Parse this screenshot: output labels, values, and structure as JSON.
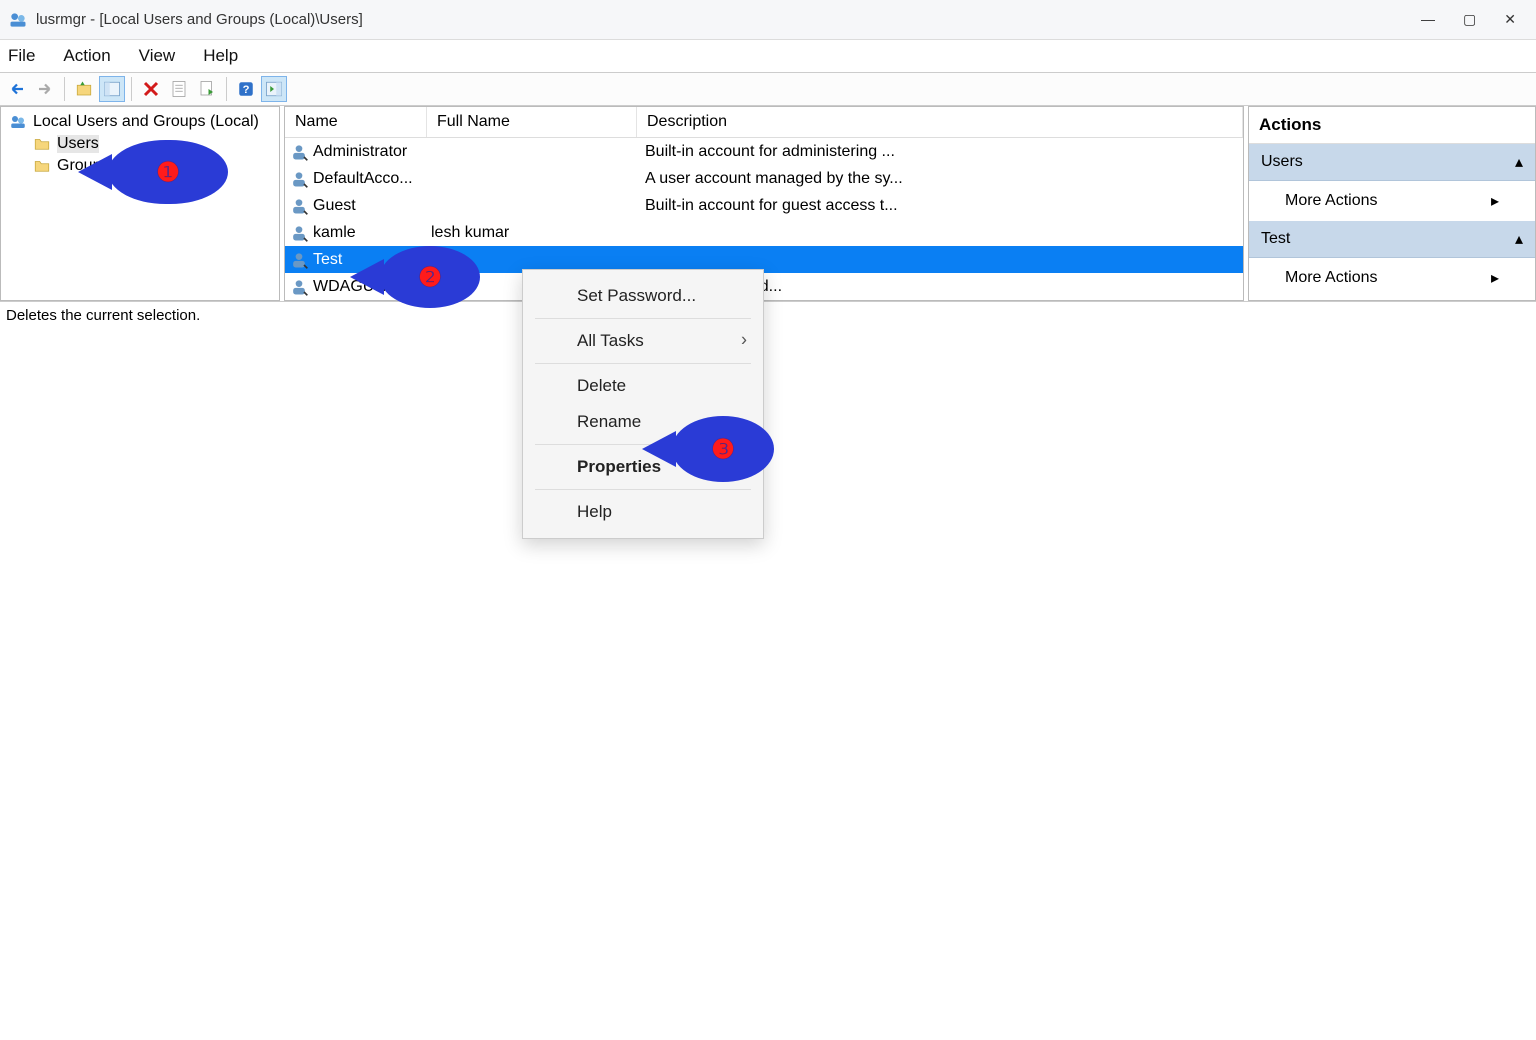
{
  "title": "lusrmgr - [Local Users and Groups (Local)\\Users]",
  "menu": {
    "file": "File",
    "action": "Action",
    "view": "View",
    "help": "Help"
  },
  "tree": {
    "root": "Local Users and Groups (Local)",
    "users": "Users",
    "groups": "Groups"
  },
  "list": {
    "cols": {
      "name": "Name",
      "full": "Full Name",
      "desc": "Description"
    },
    "rows": [
      {
        "name": "Administrator",
        "full": "",
        "desc": "Built-in account for administering ..."
      },
      {
        "name": "DefaultAcco...",
        "full": "",
        "desc": "A user account managed by the sy..."
      },
      {
        "name": "Guest",
        "full": "",
        "desc": "Built-in account for guest access t..."
      },
      {
        "name": "kamle",
        "full": "lesh kumar",
        "desc": ""
      },
      {
        "name": "Test",
        "full": "",
        "desc": "",
        "selected": true
      },
      {
        "name": "WDAGUtility...",
        "full": "",
        "desc": "anaged and used..."
      }
    ]
  },
  "actions": {
    "paneTitle": "Actions",
    "section1": "Users",
    "section2": "Test",
    "more": "More Actions"
  },
  "ctx": {
    "setpw": "Set Password...",
    "alltasks": "All Tasks",
    "delete": "Delete",
    "rename": "Rename",
    "props": "Properties",
    "help": "Help"
  },
  "status": "Deletes the current selection.",
  "badges": {
    "b1": "❶",
    "b2": "❷",
    "b3": "❸"
  }
}
